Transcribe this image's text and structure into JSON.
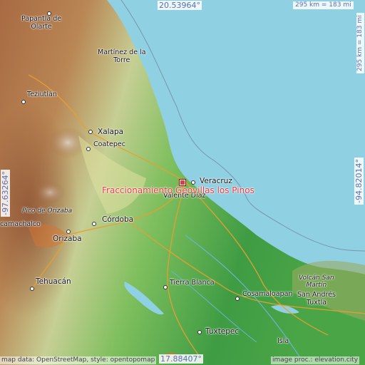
{
  "map": {
    "title": "Fraccionamiento Geovillas los Pinos",
    "coords": {
      "top": "20.53964°",
      "bottom": "17.88407°",
      "left": "-97.63264°",
      "right": "-94.82014°"
    },
    "scale_top": "295 km = 183 mi",
    "scale_right": "295 km = 183 mi",
    "attribution_left": "map data: OpenStreetMap, style: opentopomap",
    "attribution_right": "image proc.: elevation.city",
    "places": [
      {
        "id": "papantla",
        "name": "Papantla de\nOlarte"
      },
      {
        "id": "martinez",
        "name": "Martínez de la\nTorre"
      },
      {
        "id": "teziutlan",
        "name": "Teziutlán"
      },
      {
        "id": "xalapa",
        "name": "Xalapa"
      },
      {
        "id": "coatepec",
        "name": "Coatepec"
      },
      {
        "id": "veracruz",
        "name": "Veracruz"
      },
      {
        "id": "valente",
        "name": "Valente Díaz"
      },
      {
        "id": "pico",
        "name": "Pico de Orizaba"
      },
      {
        "id": "camachalco",
        "name": "camachalco"
      },
      {
        "id": "cordoba",
        "name": "Córdoba"
      },
      {
        "id": "orizaba",
        "name": "Orizaba"
      },
      {
        "id": "tehuacan",
        "name": "Tehuacán"
      },
      {
        "id": "tierra_blanca",
        "name": "Tierra Blanca"
      },
      {
        "id": "cosamaloapan",
        "name": "Cosamaloapan"
      },
      {
        "id": "volcan",
        "name": "Volcán San\nMartín"
      },
      {
        "id": "san_andres",
        "name": "San Andrés\nTuxtla"
      },
      {
        "id": "tuxtepec",
        "name": "Tuxtepec"
      },
      {
        "id": "isla",
        "name": "Isla"
      }
    ],
    "colors": {
      "sea": "#8fd0e2",
      "lowland": "#4fa84a",
      "midland": "#c9d79a",
      "highland": "#b9794d",
      "marker": "#e8383d",
      "coord_text": "#5b6fb7"
    }
  }
}
